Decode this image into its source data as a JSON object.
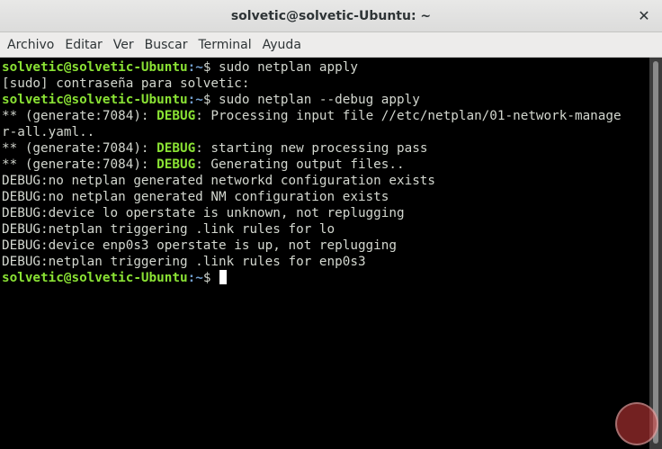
{
  "window": {
    "title": "solvetic@solvetic-Ubuntu: ~",
    "close_glyph": "✕"
  },
  "menu": [
    "Archivo",
    "Editar",
    "Ver",
    "Buscar",
    "Terminal",
    "Ayuda"
  ],
  "terminal": {
    "prompt_user": "solvetic@solvetic-Ubuntu",
    "prompt_path": ":~",
    "prompt_symbol": "$",
    "cmd1": " sudo netplan apply",
    "sudo_prompt": "[sudo] contraseña para solvetic:",
    "cmd2": " sudo netplan --debug apply",
    "gen_prefix": "** (generate:7084): ",
    "debug_tag": "DEBUG",
    "gen1": ": Processing input file //etc/netplan/01-network-manage",
    "gen1_wrap": "r-all.yaml..",
    "gen2": ": starting new processing pass",
    "gen3": ": Generating output files..",
    "debug_lines": [
      "DEBUG:no netplan generated networkd configuration exists",
      "DEBUG:no netplan generated NM configuration exists",
      "DEBUG:device lo operstate is unknown, not replugging",
      "DEBUG:netplan triggering .link rules for lo",
      "DEBUG:device enp0s3 operstate is up, not replugging",
      "DEBUG:netplan triggering .link rules for enp0s3"
    ]
  },
  "colors": {
    "prompt": "#8ae234",
    "path": "#729fcf",
    "text": "#d3d7cf",
    "background": "#000000"
  },
  "icons": {
    "close": "close-icon",
    "watermark": "solvetic-logo"
  }
}
